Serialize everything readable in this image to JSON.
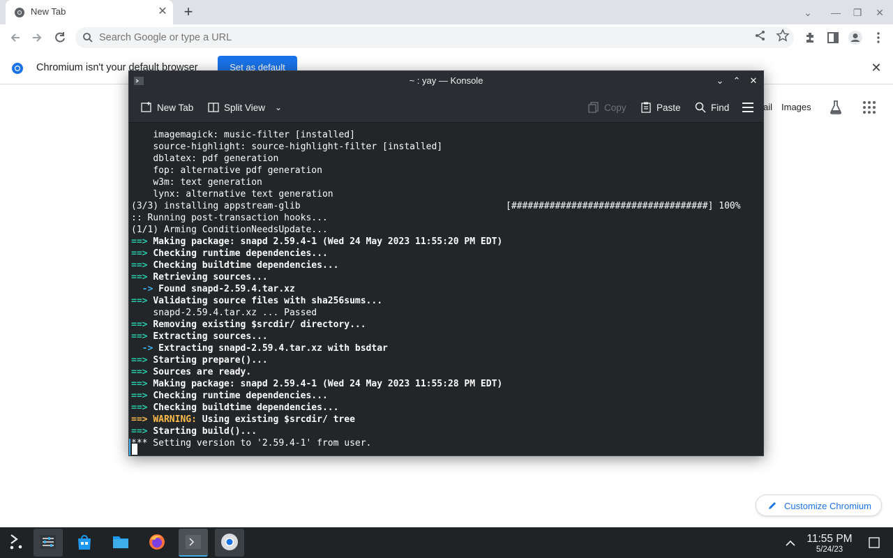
{
  "browser": {
    "tab_title": "New Tab",
    "omnibox_placeholder": "Search Google or type a URL",
    "infobar_text": "Chromium isn't your default browser",
    "infobar_button": "Set as default",
    "ntp_links": {
      "gmail": "ail",
      "images": "Images"
    },
    "customize_label": "Customize Chromium"
  },
  "konsole": {
    "title": "~ : yay — Konsole",
    "toolbar": {
      "new_tab": "New Tab",
      "split_view": "Split View",
      "copy": "Copy",
      "paste": "Paste",
      "find": "Find"
    },
    "lines": [
      {
        "indent": "    ",
        "text": "imagemagick: music-filter [installed]"
      },
      {
        "indent": "    ",
        "text": "source-highlight: source-highlight-filter [installed]"
      },
      {
        "indent": "    ",
        "text": "dblatex: pdf generation"
      },
      {
        "indent": "    ",
        "text": "fop: alternative pdf generation"
      },
      {
        "indent": "    ",
        "text": "w3m: text generation"
      },
      {
        "indent": "    ",
        "text": "lynx: alternative text generation"
      },
      {
        "indent": "",
        "text": "(3/3) installing appstream-glib"
      },
      {
        "indent": "",
        "text": ":: Running post-transaction hooks..."
      },
      {
        "indent": "",
        "text": "(1/1) Arming ConditionNeedsUpdate..."
      },
      {
        "arrow": "==>",
        "bold": "Making package: snapd 2.59.4-1 (Wed 24 May 2023 11:55:20 PM EDT)"
      },
      {
        "arrow": "==>",
        "bold": "Checking runtime dependencies..."
      },
      {
        "arrow": "==>",
        "bold": "Checking buildtime dependencies..."
      },
      {
        "arrow": "==>",
        "bold": "Retrieving sources..."
      },
      {
        "subarrow": "  ->",
        "bold": "Found snapd-2.59.4.tar.xz"
      },
      {
        "arrow": "==>",
        "bold": "Validating source files with sha256sums..."
      },
      {
        "indent": "    ",
        "text": "snapd-2.59.4.tar.xz ... Passed"
      },
      {
        "arrow": "==>",
        "bold": "Removing existing $srcdir/ directory..."
      },
      {
        "arrow": "==>",
        "bold": "Extracting sources..."
      },
      {
        "subarrow": "  ->",
        "bold": "Extracting snapd-2.59.4.tar.xz with bsdtar"
      },
      {
        "arrow": "==>",
        "bold": "Starting prepare()..."
      },
      {
        "arrow": "==>",
        "bold": "Sources are ready."
      },
      {
        "arrow": "==>",
        "bold": "Making package: snapd 2.59.4-1 (Wed 24 May 2023 11:55:28 PM EDT)"
      },
      {
        "arrow": "==>",
        "bold": "Checking runtime dependencies..."
      },
      {
        "arrow": "==>",
        "bold": "Checking buildtime dependencies..."
      },
      {
        "warnarrow": "==>",
        "warn": "WARNING:",
        "bold": "Using existing $srcdir/ tree"
      },
      {
        "arrow": "==>",
        "bold": "Starting build()..."
      },
      {
        "indent": "",
        "text": "*** Setting version to '2.59.4-1' from user."
      }
    ],
    "progress_text": "[####################################] 100%"
  },
  "taskbar": {
    "time": "11:55 PM",
    "date": "5/24/23"
  },
  "colors": {
    "accent": "#1a73e8",
    "konsole_bg": "#232629",
    "arrow_green": "#27c9a8",
    "arrow_blue": "#3daee9",
    "warning": "#fdbc4b"
  }
}
